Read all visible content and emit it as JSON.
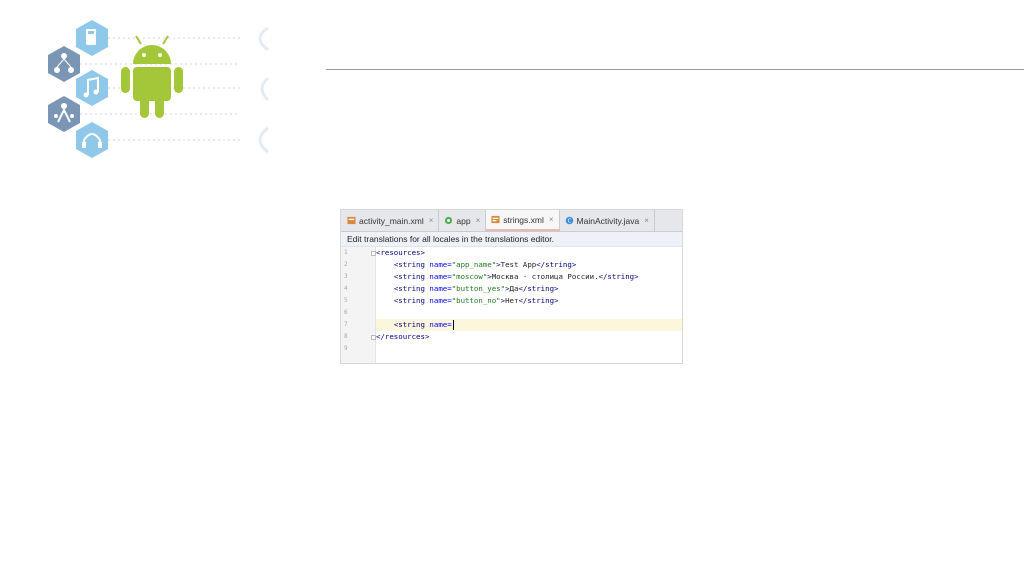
{
  "editor": {
    "tabs": [
      {
        "label": "activity_main.xml",
        "icon": "xml-layout-icon",
        "active": false
      },
      {
        "label": "app",
        "icon": "module-icon",
        "active": false
      },
      {
        "label": "strings.xml",
        "icon": "xml-values-icon",
        "active": true
      },
      {
        "label": "MainActivity.java",
        "icon": "java-class-icon",
        "active": false
      }
    ],
    "close_glyph": "×",
    "notice": "Edit translations for all locales in the translations editor.",
    "line_numbers": [
      "1",
      "2",
      "3",
      "4",
      "5",
      "6",
      "7",
      "8",
      "9"
    ],
    "lines": {
      "l1": {
        "open": "<resources>"
      },
      "l2": {
        "tag": "<string ",
        "attr": "name=",
        "val": "\"app_name\"",
        "close": ">",
        "text": "Test App",
        "end": "</string>"
      },
      "l3": {
        "tag": "<string ",
        "attr": "name=",
        "val": "\"moscow\"",
        "close": ">",
        "text": "Москва - столица России.",
        "end": "</string>"
      },
      "l4": {
        "tag": "<string ",
        "attr": "name=",
        "val": "\"button_yes\"",
        "close": ">",
        "text": "Да",
        "end": "</string>"
      },
      "l5": {
        "tag": "<string ",
        "attr": "name=",
        "val": "\"button_no\"",
        "close": ">",
        "text": "Нет",
        "end": "</string>"
      },
      "l7": {
        "tag": "<string ",
        "attr": "name="
      },
      "l8": {
        "close": "</resources>"
      }
    }
  },
  "colors": {
    "android_green": "#a4c639",
    "deco_blue": "#8fc8e8",
    "deco_gray": "#7a96b4"
  }
}
